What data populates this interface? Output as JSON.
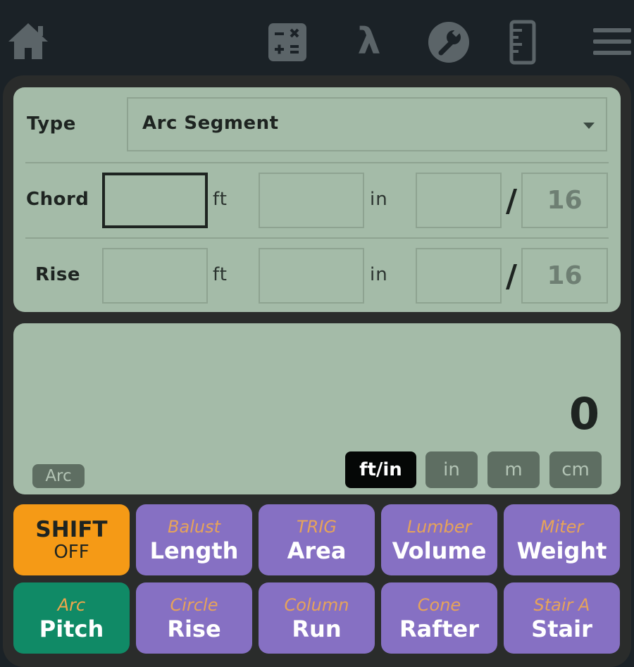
{
  "nav": {
    "icons": [
      "home-icon",
      "calculator-icon",
      "lambda-icon",
      "wrench-icon",
      "ruler-icon",
      "menu-icon"
    ],
    "lambda_glyph": "λ"
  },
  "form": {
    "type_label": "Type",
    "type_value": "Arc Segment",
    "chord_label": "Chord",
    "rise_label": "Rise",
    "unit_ft": "ft",
    "unit_in": "in",
    "slash": "/",
    "chord_denominator": "16",
    "rise_denominator": "16"
  },
  "display": {
    "result": "0",
    "mode_tag": "Arc",
    "units": [
      "ft/in",
      "in",
      "m",
      "cm"
    ],
    "selected_unit": "ft/in"
  },
  "keys": {
    "shift": {
      "label": "SHIFT",
      "state": "OFF"
    },
    "length": {
      "secondary": "Balust",
      "primary": "Length"
    },
    "area": {
      "secondary": "TRIG",
      "primary": "Area"
    },
    "volume": {
      "secondary": "Lumber",
      "primary": "Volume"
    },
    "weight": {
      "secondary": "Miter",
      "primary": "Weight"
    },
    "pitch": {
      "secondary": "Arc",
      "primary": "Pitch"
    },
    "rise": {
      "secondary": "Circle",
      "primary": "Rise"
    },
    "run": {
      "secondary": "Column",
      "primary": "Run"
    },
    "rafter": {
      "secondary": "Cone",
      "primary": "Rafter"
    },
    "stair": {
      "secondary": "Stair A",
      "primary": "Stair"
    }
  },
  "colors": {
    "background": "#1b2227",
    "card": "#a4bba8",
    "key_purple": "#8670c3",
    "key_green": "#108a66",
    "key_shift": "#f59a16",
    "secondary_text": "#e6a35a"
  }
}
